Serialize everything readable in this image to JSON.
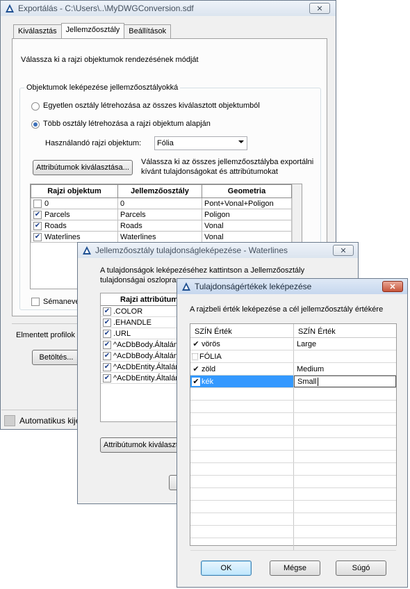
{
  "main_window": {
    "title": "Exportálás - C:\\Users\\..\\MyDWGConversion.sdf",
    "close_glyph": "✕",
    "tabs": [
      "Kiválasztás",
      "Jellemzőosztály",
      "Beállítások"
    ],
    "selected_tab": "Jellemzőosztály",
    "intro": "Válassza ki a rajzi objektumok rendezésének módját",
    "group_title": "Objektumok leképezése jellemzőosztályokká",
    "radio_single": "Egyetlen osztály létrehozása az összes kiválasztott objektumból",
    "radio_multi": "Több osztály létrehozása a rajzi objektum alapján",
    "radio_selected": "multi",
    "object_label": "Használandó rajzi objektum:",
    "object_value": "Fólia",
    "attr_button": "Attribútumok kiválasztása...",
    "attr_hint_1": "Válassza ki az összes jellemzőosztályba exportálni",
    "attr_hint_2": "kívánt tulajdonságokat és attribútumokat",
    "table": {
      "headers": [
        "Rajzi objektum",
        "Jellemzőosztály",
        "Geometria"
      ],
      "rows": [
        {
          "checked": false,
          "obj": "0",
          "cls": "0",
          "geom": "Pont+Vonal+Poligon"
        },
        {
          "checked": true,
          "obj": "Parcels",
          "cls": "Parcels",
          "geom": "Poligon"
        },
        {
          "checked": true,
          "obj": "Roads",
          "cls": "Roads",
          "geom": "Vonal"
        },
        {
          "checked": true,
          "obj": "Waterlines",
          "cls": "Waterlines",
          "geom": "Vonal"
        }
      ]
    },
    "schema_check": "Sémanevel",
    "saved_profiles": "Elmentett profilok",
    "load_button": "Betöltés...",
    "status_text": "Automatikus kijel"
  },
  "mid_window": {
    "title": "Jellemzőosztály tulajdonságleképezése - Waterlines",
    "close_glyph": "✕",
    "desc_1": "A tulajdonságok leképezéséhez kattintson a Jellemzőosztály",
    "desc_2": "tulajdonságai oszlopra",
    "col_header": "Rajzi attribútum",
    "rows": [
      ".COLOR",
      ".EHANDLE",
      ".URL",
      "^AcDbBody.Általán",
      "^AcDbBody.Általán",
      "^AcDbEntity.Általán",
      "^AcDbEntity.Általán"
    ],
    "attr_button": "Attribútumok kiválaszt"
  },
  "front_window": {
    "title": "Tulajdonságértékek leképezése",
    "close_glyph": "✕",
    "desc": "A rajzbeli érték leképezése a cél jellemzőosztály értékére",
    "col1": "SZÍN Érték",
    "col2": "SZÍN Érték",
    "rows": [
      {
        "check": "✔",
        "src": "vörös",
        "dst": "Large",
        "style": "check"
      },
      {
        "check": "",
        "src": "FÓLIA",
        "dst": "",
        "style": "dotted"
      },
      {
        "check": "✔",
        "src": "zöld",
        "dst": "Medium",
        "style": "check"
      },
      {
        "check": "✔",
        "src": "kék",
        "dst": "Small",
        "style": "selected"
      }
    ],
    "ok": "OK",
    "cancel": "Mégse",
    "help": "Súgó"
  }
}
